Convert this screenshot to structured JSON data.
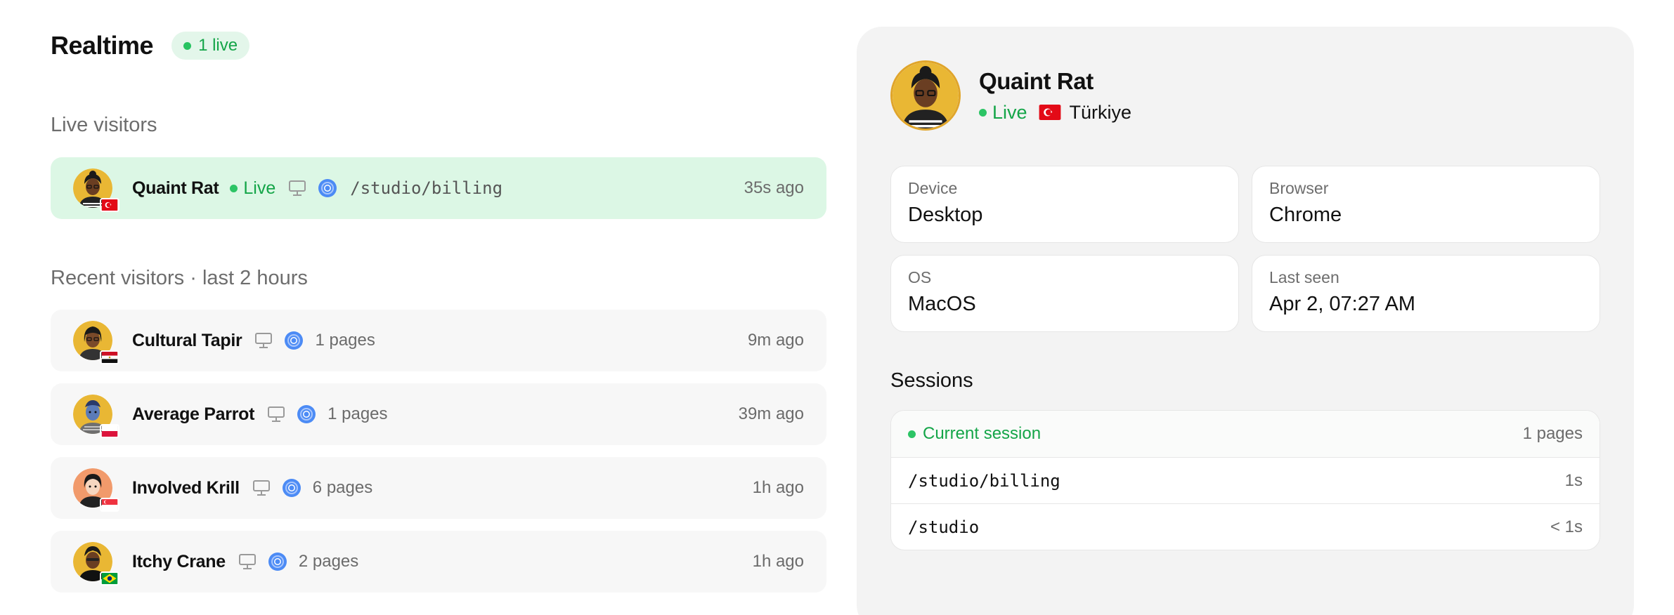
{
  "header": {
    "title": "Realtime",
    "live_count": "1 live"
  },
  "live_section": {
    "label": "Live visitors",
    "visitor": {
      "name": "Quaint Rat",
      "status": "Live",
      "device_icon": "desktop-icon",
      "browser_icon": "chrome-icon",
      "path": "/studio/billing",
      "ago": "35s ago",
      "flag": "tr"
    }
  },
  "recent_section": {
    "label": "Recent visitors · last 2 hours",
    "visitors": [
      {
        "name": "Cultural Tapir",
        "pages": "1 pages",
        "ago": "9m ago",
        "flag": "eg"
      },
      {
        "name": "Average Parrot",
        "pages": "1 pages",
        "ago": "39m ago",
        "flag": "pl"
      },
      {
        "name": "Involved Krill",
        "pages": "6 pages",
        "ago": "1h ago",
        "flag": "sg"
      },
      {
        "name": "Itchy Crane",
        "pages": "2 pages",
        "ago": "1h ago",
        "flag": "br"
      }
    ]
  },
  "detail": {
    "name": "Quaint Rat",
    "status": "Live",
    "country": "Türkiye",
    "device": {
      "label": "Device",
      "value": "Desktop"
    },
    "browser": {
      "label": "Browser",
      "value": "Chrome"
    },
    "os": {
      "label": "OS",
      "value": "MacOS"
    },
    "last_seen": {
      "label": "Last seen",
      "value": "Apr 2, 07:27 AM"
    },
    "sessions_title": "Sessions",
    "current_session": {
      "label": "Current session",
      "pages": "1 pages"
    },
    "session_pages": [
      {
        "path": "/studio/billing",
        "time": "1s"
      },
      {
        "path": "/studio",
        "time": "< 1s"
      }
    ]
  },
  "colors": {
    "live_green": "#14a548",
    "live_bg": "#dcf7e5",
    "avatar_yellow": "#e9b734",
    "avatar_orange": "#f19a6b"
  }
}
